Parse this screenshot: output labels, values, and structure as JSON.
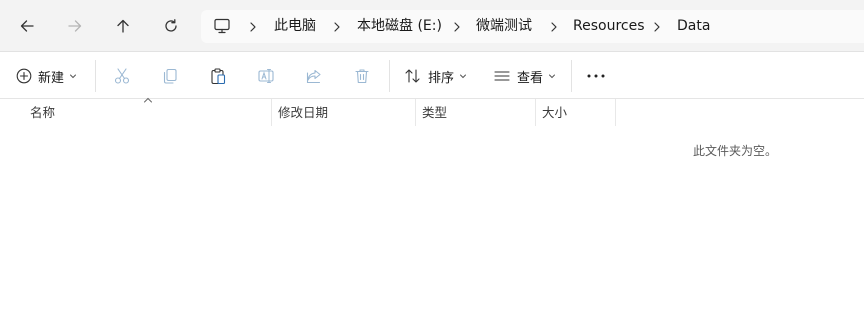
{
  "navigation": {
    "back_icon": "arrow-left-icon",
    "forward_icon": "arrow-right-icon",
    "up_icon": "arrow-up-icon",
    "refresh_icon": "refresh-icon"
  },
  "address_bar": {
    "root_icon": "computer-icon",
    "breadcrumbs": [
      "此电脑",
      "本地磁盘 (E:)",
      "微端测试",
      "Resources",
      "Data"
    ]
  },
  "toolbar": {
    "new_label": "新建",
    "sort_label": "排序",
    "view_label": "查看",
    "actions": [
      "cut-icon",
      "copy-icon",
      "paste-icon",
      "rename-icon",
      "share-icon",
      "delete-icon"
    ],
    "more_icon": "more-icon"
  },
  "columns": {
    "name": "名称",
    "modified": "修改日期",
    "type": "类型",
    "size": "大小"
  },
  "content": {
    "empty_message": "此文件夹为空。"
  },
  "colors": {
    "topbar_bg": "#f3f3f3",
    "disabled_icon": "#9bb8d3",
    "active_icon": "#2b6cb0"
  }
}
